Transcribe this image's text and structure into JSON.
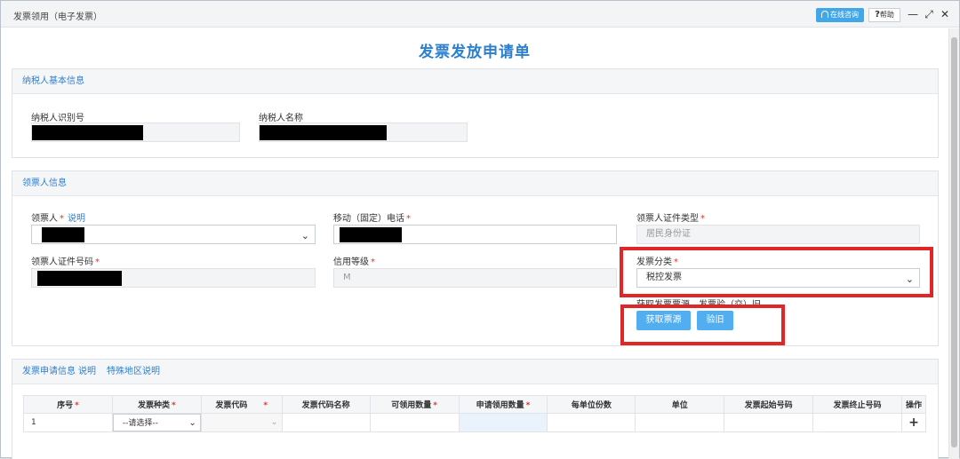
{
  "window": {
    "title": "发票领用（电子发票）",
    "online_label": "在线咨询",
    "help_icon_text": "?",
    "help_label": "帮助",
    "minimize_glyph": "—",
    "maximize_glyph": "⤢",
    "close_glyph": "✕"
  },
  "page_title": "发票发放申请单",
  "taxpayer": {
    "section_title": "纳税人基本信息",
    "id_label": "纳税人识别号",
    "name_label": "纳税人名称"
  },
  "receiver": {
    "section_title": "领票人信息",
    "name_label": "领票人",
    "name_help": "说明",
    "phone_label": "移动（固定）电话",
    "idtype_label": "领票人证件类型",
    "idtype_value": "居民身份证",
    "idno_label": "领票人证件号码",
    "credit_label": "信用等级",
    "credit_value": "M",
    "category_label": "发票分类",
    "category_value": "税控发票",
    "source_label": "获取发票票源，发票验（交）旧",
    "get_source_button": "获取票源",
    "verify_button": "验旧"
  },
  "apply": {
    "section_title": "发票申请信息",
    "help_link": "说明",
    "special_link": "特殊地区说明",
    "columns": [
      "序号",
      "发票种类",
      "发票代码",
      "发票代码名称",
      "可领用数量",
      "申请领用数量",
      "每单位份数",
      "单位",
      "发票起始号码",
      "发票终止号码",
      "操作"
    ],
    "row": {
      "index": "1",
      "type_placeholder": "--请选择--",
      "add_glyph": "+"
    }
  },
  "colors": {
    "accent": "#2d7fcf",
    "button": "#52aef0",
    "required": "#e0352b",
    "highlight": "#e02626"
  }
}
